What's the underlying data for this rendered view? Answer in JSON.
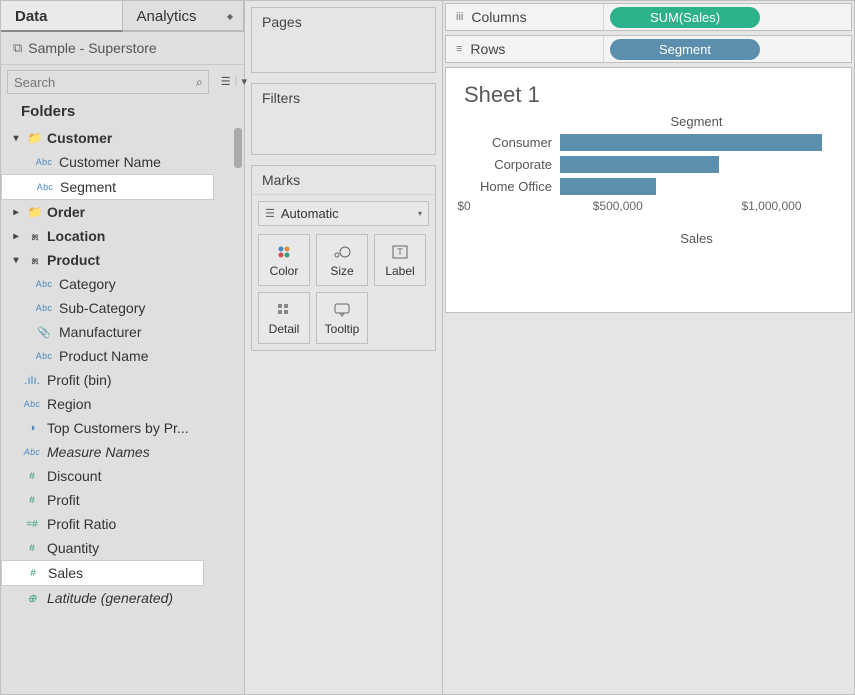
{
  "tabs": {
    "data": "Data",
    "analytics": "Analytics"
  },
  "datasource": "Sample - Superstore",
  "search": {
    "placeholder": "Search"
  },
  "folders_label": "Folders",
  "folders": {
    "customer": {
      "label": "Customer",
      "fields": [
        "Customer Name",
        "Segment"
      ]
    },
    "order": {
      "label": "Order"
    },
    "location": {
      "label": "Location"
    },
    "product": {
      "label": "Product",
      "fields": [
        "Category",
        "Sub-Category",
        "Manufacturer",
        "Product Name"
      ]
    }
  },
  "loose_fields": {
    "profit_bin": "Profit (bin)",
    "region": "Region",
    "top_customers": "Top Customers by Pr...",
    "measure_names": "Measure Names",
    "discount": "Discount",
    "profit": "Profit",
    "profit_ratio": "Profit Ratio",
    "quantity": "Quantity",
    "sales": "Sales",
    "latitude": "Latitude (generated)"
  },
  "pages_label": "Pages",
  "filters_label": "Filters",
  "marks": {
    "label": "Marks",
    "type": "Automatic",
    "cells": {
      "color": "Color",
      "size": "Size",
      "label": "Label",
      "detail": "Detail",
      "tooltip": "Tooltip"
    }
  },
  "shelves": {
    "columns": {
      "label": "Columns",
      "pill": "SUM(Sales)"
    },
    "rows": {
      "label": "Rows",
      "pill": "Segment"
    }
  },
  "sheet_title": "Sheet 1",
  "chart_data": {
    "type": "bar",
    "title": "Segment",
    "categories": [
      "Consumer",
      "Corporate",
      "Home Office"
    ],
    "values": [
      1150000,
      700000,
      420000
    ],
    "xlabel": "Sales",
    "xlim": [
      0,
      1200000
    ],
    "ticks": [
      {
        "v": 0,
        "label": "$0"
      },
      {
        "v": 500000,
        "label": "$500,000"
      },
      {
        "v": 1000000,
        "label": "$1,000,000"
      }
    ]
  }
}
